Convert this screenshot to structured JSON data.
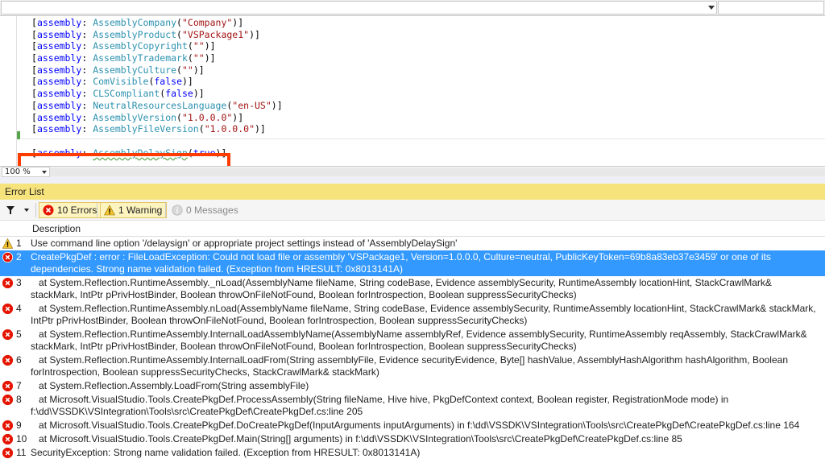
{
  "editor": {
    "lines": [
      [
        {
          "t": "[",
          "c": "br"
        },
        {
          "t": "assembly",
          "c": "kw"
        },
        {
          "t": ": ",
          "c": "br"
        },
        {
          "t": "AssemblyCompany",
          "c": "ty"
        },
        {
          "t": "(",
          "c": "br"
        },
        {
          "t": "\"Company\"",
          "c": "str"
        },
        {
          "t": ")]",
          "c": "br"
        }
      ],
      [
        {
          "t": "[",
          "c": "br"
        },
        {
          "t": "assembly",
          "c": "kw"
        },
        {
          "t": ": ",
          "c": "br"
        },
        {
          "t": "AssemblyProduct",
          "c": "ty"
        },
        {
          "t": "(",
          "c": "br"
        },
        {
          "t": "\"VSPackage1\"",
          "c": "str"
        },
        {
          "t": ")]",
          "c": "br"
        }
      ],
      [
        {
          "t": "[",
          "c": "br"
        },
        {
          "t": "assembly",
          "c": "kw"
        },
        {
          "t": ": ",
          "c": "br"
        },
        {
          "t": "AssemblyCopyright",
          "c": "ty"
        },
        {
          "t": "(",
          "c": "br"
        },
        {
          "t": "\"\"",
          "c": "str"
        },
        {
          "t": ")]",
          "c": "br"
        }
      ],
      [
        {
          "t": "[",
          "c": "br"
        },
        {
          "t": "assembly",
          "c": "kw"
        },
        {
          "t": ": ",
          "c": "br"
        },
        {
          "t": "AssemblyTrademark",
          "c": "ty"
        },
        {
          "t": "(",
          "c": "br"
        },
        {
          "t": "\"\"",
          "c": "str"
        },
        {
          "t": ")]",
          "c": "br"
        }
      ],
      [
        {
          "t": "[",
          "c": "br"
        },
        {
          "t": "assembly",
          "c": "kw"
        },
        {
          "t": ": ",
          "c": "br"
        },
        {
          "t": "AssemblyCulture",
          "c": "ty"
        },
        {
          "t": "(",
          "c": "br"
        },
        {
          "t": "\"\"",
          "c": "str"
        },
        {
          "t": ")]",
          "c": "br"
        }
      ],
      [
        {
          "t": "[",
          "c": "br"
        },
        {
          "t": "assembly",
          "c": "kw"
        },
        {
          "t": ": ",
          "c": "br"
        },
        {
          "t": "ComVisible",
          "c": "ty"
        },
        {
          "t": "(",
          "c": "br"
        },
        {
          "t": "false",
          "c": "kw"
        },
        {
          "t": ")]",
          "c": "br"
        }
      ],
      [
        {
          "t": "[",
          "c": "br"
        },
        {
          "t": "assembly",
          "c": "kw"
        },
        {
          "t": ": ",
          "c": "br"
        },
        {
          "t": "CLSCompliant",
          "c": "ty"
        },
        {
          "t": "(",
          "c": "br"
        },
        {
          "t": "false",
          "c": "kw"
        },
        {
          "t": ")]",
          "c": "br"
        }
      ],
      [
        {
          "t": "[",
          "c": "br"
        },
        {
          "t": "assembly",
          "c": "kw"
        },
        {
          "t": ": ",
          "c": "br"
        },
        {
          "t": "NeutralResourcesLanguage",
          "c": "ty"
        },
        {
          "t": "(",
          "c": "br"
        },
        {
          "t": "\"en-US\"",
          "c": "str"
        },
        {
          "t": ")]",
          "c": "br"
        }
      ],
      [
        {
          "t": "[",
          "c": "br"
        },
        {
          "t": "assembly",
          "c": "kw"
        },
        {
          "t": ": ",
          "c": "br"
        },
        {
          "t": "AssemblyVersion",
          "c": "ty"
        },
        {
          "t": "(",
          "c": "br"
        },
        {
          "t": "\"1.0.0.0\"",
          "c": "str"
        },
        {
          "t": ")]",
          "c": "br"
        }
      ],
      [
        {
          "t": "[",
          "c": "br"
        },
        {
          "t": "assembly",
          "c": "kw"
        },
        {
          "t": ": ",
          "c": "br"
        },
        {
          "t": "AssemblyFileVersion",
          "c": "ty"
        },
        {
          "t": "(",
          "c": "br"
        },
        {
          "t": "\"1.0.0.0\"",
          "c": "str"
        },
        {
          "t": ")]",
          "c": "br"
        }
      ]
    ],
    "delay_line": [
      {
        "t": "[",
        "c": "br"
      },
      {
        "t": "assembly",
        "c": "kw"
      },
      {
        "t": ": ",
        "c": "br"
      },
      {
        "t": "AssemblyDelaySign",
        "c": "ty squig"
      },
      {
        "t": "(",
        "c": "br"
      },
      {
        "t": "true",
        "c": "kw"
      },
      {
        "t": ")]",
        "c": "br"
      }
    ],
    "zoom": "100 %"
  },
  "error_list": {
    "title": "Error List",
    "errors_label": "10 Errors",
    "warnings_label": "1 Warning",
    "messages_label": "0 Messages",
    "column_description": "Description",
    "rows": [
      {
        "num": "1",
        "type": "warning",
        "text": "Use command line option '/delaysign' or appropriate project settings instead of 'AssemblyDelaySign'"
      },
      {
        "num": "2",
        "type": "error",
        "selected": true,
        "text": "CreatePkgDef : error : FileLoadException: Could not load file or assembly 'VSPackage1, Version=1.0.0.0, Culture=neutral, PublicKeyToken=69b8a83eb37e3459' or one of its dependencies. Strong name validation failed. (Exception from HRESULT: 0x8013141A)"
      },
      {
        "num": "3",
        "type": "error",
        "text": "   at System.Reflection.RuntimeAssembly._nLoad(AssemblyName fileName, String codeBase, Evidence assemblySecurity, RuntimeAssembly locationHint, StackCrawlMark& stackMark, IntPtr pPrivHostBinder, Boolean throwOnFileNotFound, Boolean forIntrospection, Boolean suppressSecurityChecks)"
      },
      {
        "num": "4",
        "type": "error",
        "text": "   at System.Reflection.RuntimeAssembly.nLoad(AssemblyName fileName, String codeBase, Evidence assemblySecurity, RuntimeAssembly locationHint, StackCrawlMark& stackMark, IntPtr pPrivHostBinder, Boolean throwOnFileNotFound, Boolean forIntrospection, Boolean suppressSecurityChecks)"
      },
      {
        "num": "5",
        "type": "error",
        "text": "   at System.Reflection.RuntimeAssembly.InternalLoadAssemblyName(AssemblyName assemblyRef, Evidence assemblySecurity, RuntimeAssembly reqAssembly, StackCrawlMark& stackMark, IntPtr pPrivHostBinder, Boolean throwOnFileNotFound, Boolean forIntrospection, Boolean suppressSecurityChecks)"
      },
      {
        "num": "6",
        "type": "error",
        "text": "   at System.Reflection.RuntimeAssembly.InternalLoadFrom(String assemblyFile, Evidence securityEvidence, Byte[] hashValue, AssemblyHashAlgorithm hashAlgorithm, Boolean forIntrospection, Boolean suppressSecurityChecks, StackCrawlMark& stackMark)"
      },
      {
        "num": "7",
        "type": "error",
        "text": "   at System.Reflection.Assembly.LoadFrom(String assemblyFile)"
      },
      {
        "num": "8",
        "type": "error",
        "text": "   at Microsoft.VisualStudio.Tools.CreatePkgDef.ProcessAssembly(String fileName, Hive hive, PkgDefContext context, Boolean register, RegistrationMode mode) in f:\\dd\\VSSDK\\VSIntegration\\Tools\\src\\CreatePkgDef\\CreatePkgDef.cs:line 205"
      },
      {
        "num": "9",
        "type": "error",
        "text": "   at Microsoft.VisualStudio.Tools.CreatePkgDef.DoCreatePkgDef(InputArguments inputArguments) in f:\\dd\\VSSDK\\VSIntegration\\Tools\\src\\CreatePkgDef\\CreatePkgDef.cs:line 164"
      },
      {
        "num": "10",
        "type": "error",
        "text": "   at Microsoft.VisualStudio.Tools.CreatePkgDef.Main(String[] arguments) in f:\\dd\\VSSDK\\VSIntegration\\Tools\\src\\CreatePkgDef\\CreatePkgDef.cs:line 85"
      },
      {
        "num": "11",
        "type": "error",
        "text": "SecurityException: Strong name validation failed. (Exception from HRESULT: 0x8013141A)"
      }
    ]
  },
  "colors": {
    "error": "#e51400",
    "warning": "#f4c430",
    "selection": "#3399ff",
    "highlight_box": "#ff3b00",
    "panel_title_bg": "#f7e37c"
  }
}
